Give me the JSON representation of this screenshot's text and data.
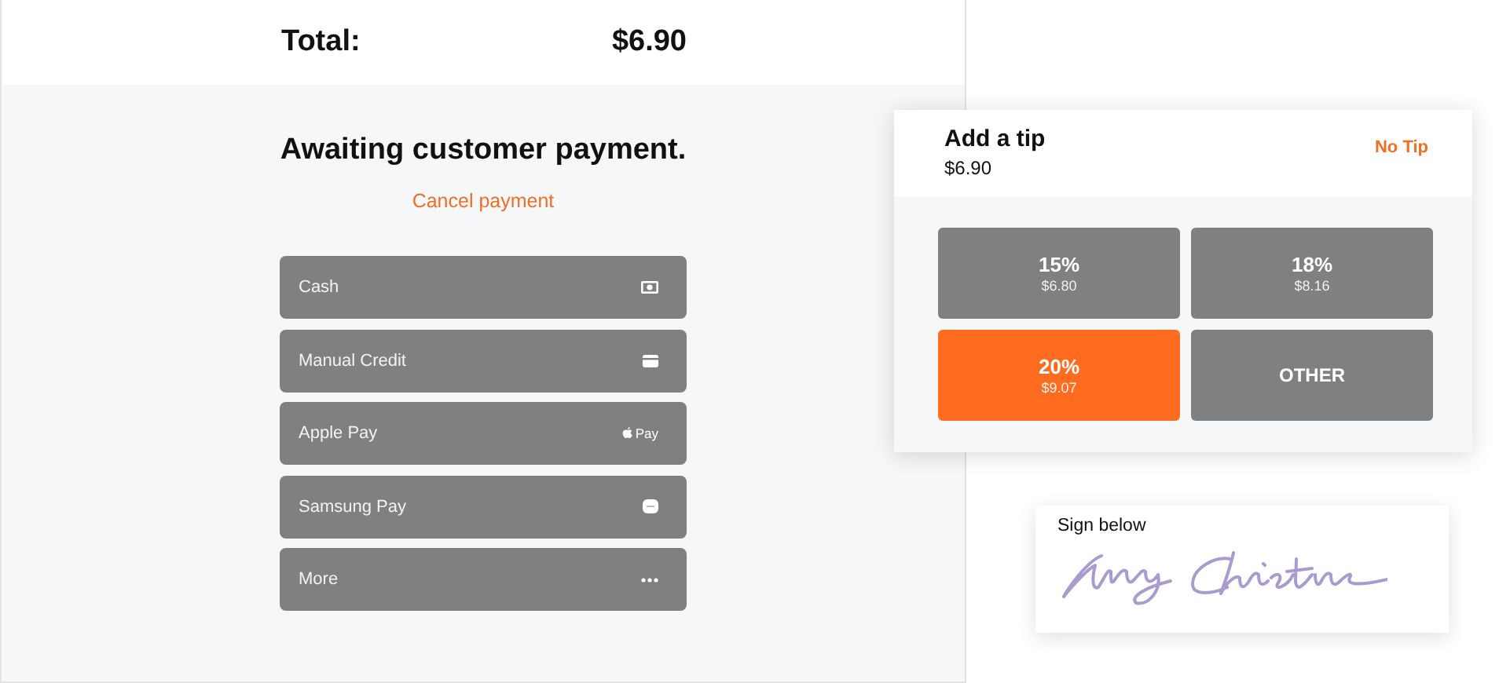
{
  "total": {
    "label": "Total:",
    "amount": "$6.90"
  },
  "status": {
    "title": "Awaiting customer payment.",
    "cancel": "Cancel payment"
  },
  "payment_methods": [
    {
      "label": "Cash",
      "kind": "cash"
    },
    {
      "label": "Manual Credit",
      "kind": "card"
    },
    {
      "label": "Apple Pay",
      "kind": "applepay",
      "badge": "Pay"
    },
    {
      "label": "Samsung Pay",
      "kind": "samsungpay"
    },
    {
      "label": "More",
      "kind": "more"
    }
  ],
  "tip": {
    "title": "Add a tip",
    "amount": "$6.90",
    "no_tip": "No Tip",
    "options": [
      {
        "kind": "percent",
        "percent": "15%",
        "amount": "$6.80",
        "selected": false
      },
      {
        "kind": "percent",
        "percent": "18%",
        "amount": "$8.16",
        "selected": false
      },
      {
        "kind": "percent",
        "percent": "20%",
        "amount": "$9.07",
        "selected": true
      },
      {
        "kind": "other",
        "label": "OTHER",
        "selected": false
      }
    ]
  },
  "signature": {
    "label": "Sign below"
  }
}
